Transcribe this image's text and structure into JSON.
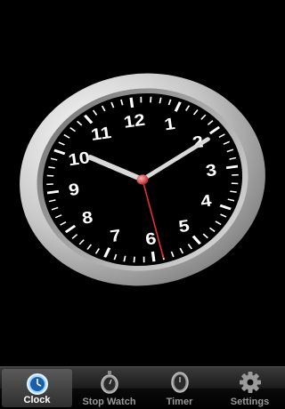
{
  "clock": {
    "numerals": [
      "12",
      "1",
      "2",
      "3",
      "4",
      "5",
      "6",
      "7",
      "8",
      "9",
      "10",
      "11"
    ],
    "time": {
      "hour": 10,
      "minute": 10,
      "second": 29
    },
    "colors": {
      "face": "#000000",
      "bezel": "#d8d8d8",
      "hands": "#d9d9d9",
      "second_hand": "#e03030",
      "numerals": "#ffffff"
    }
  },
  "tabs": [
    {
      "label": "Clock",
      "icon": "clock-icon",
      "selected": true
    },
    {
      "label": "Stop Watch",
      "icon": "stopwatch-icon",
      "selected": false
    },
    {
      "label": "Timer",
      "icon": "timer-icon",
      "selected": false
    },
    {
      "label": "Settings",
      "icon": "gear-icon",
      "selected": false
    }
  ]
}
